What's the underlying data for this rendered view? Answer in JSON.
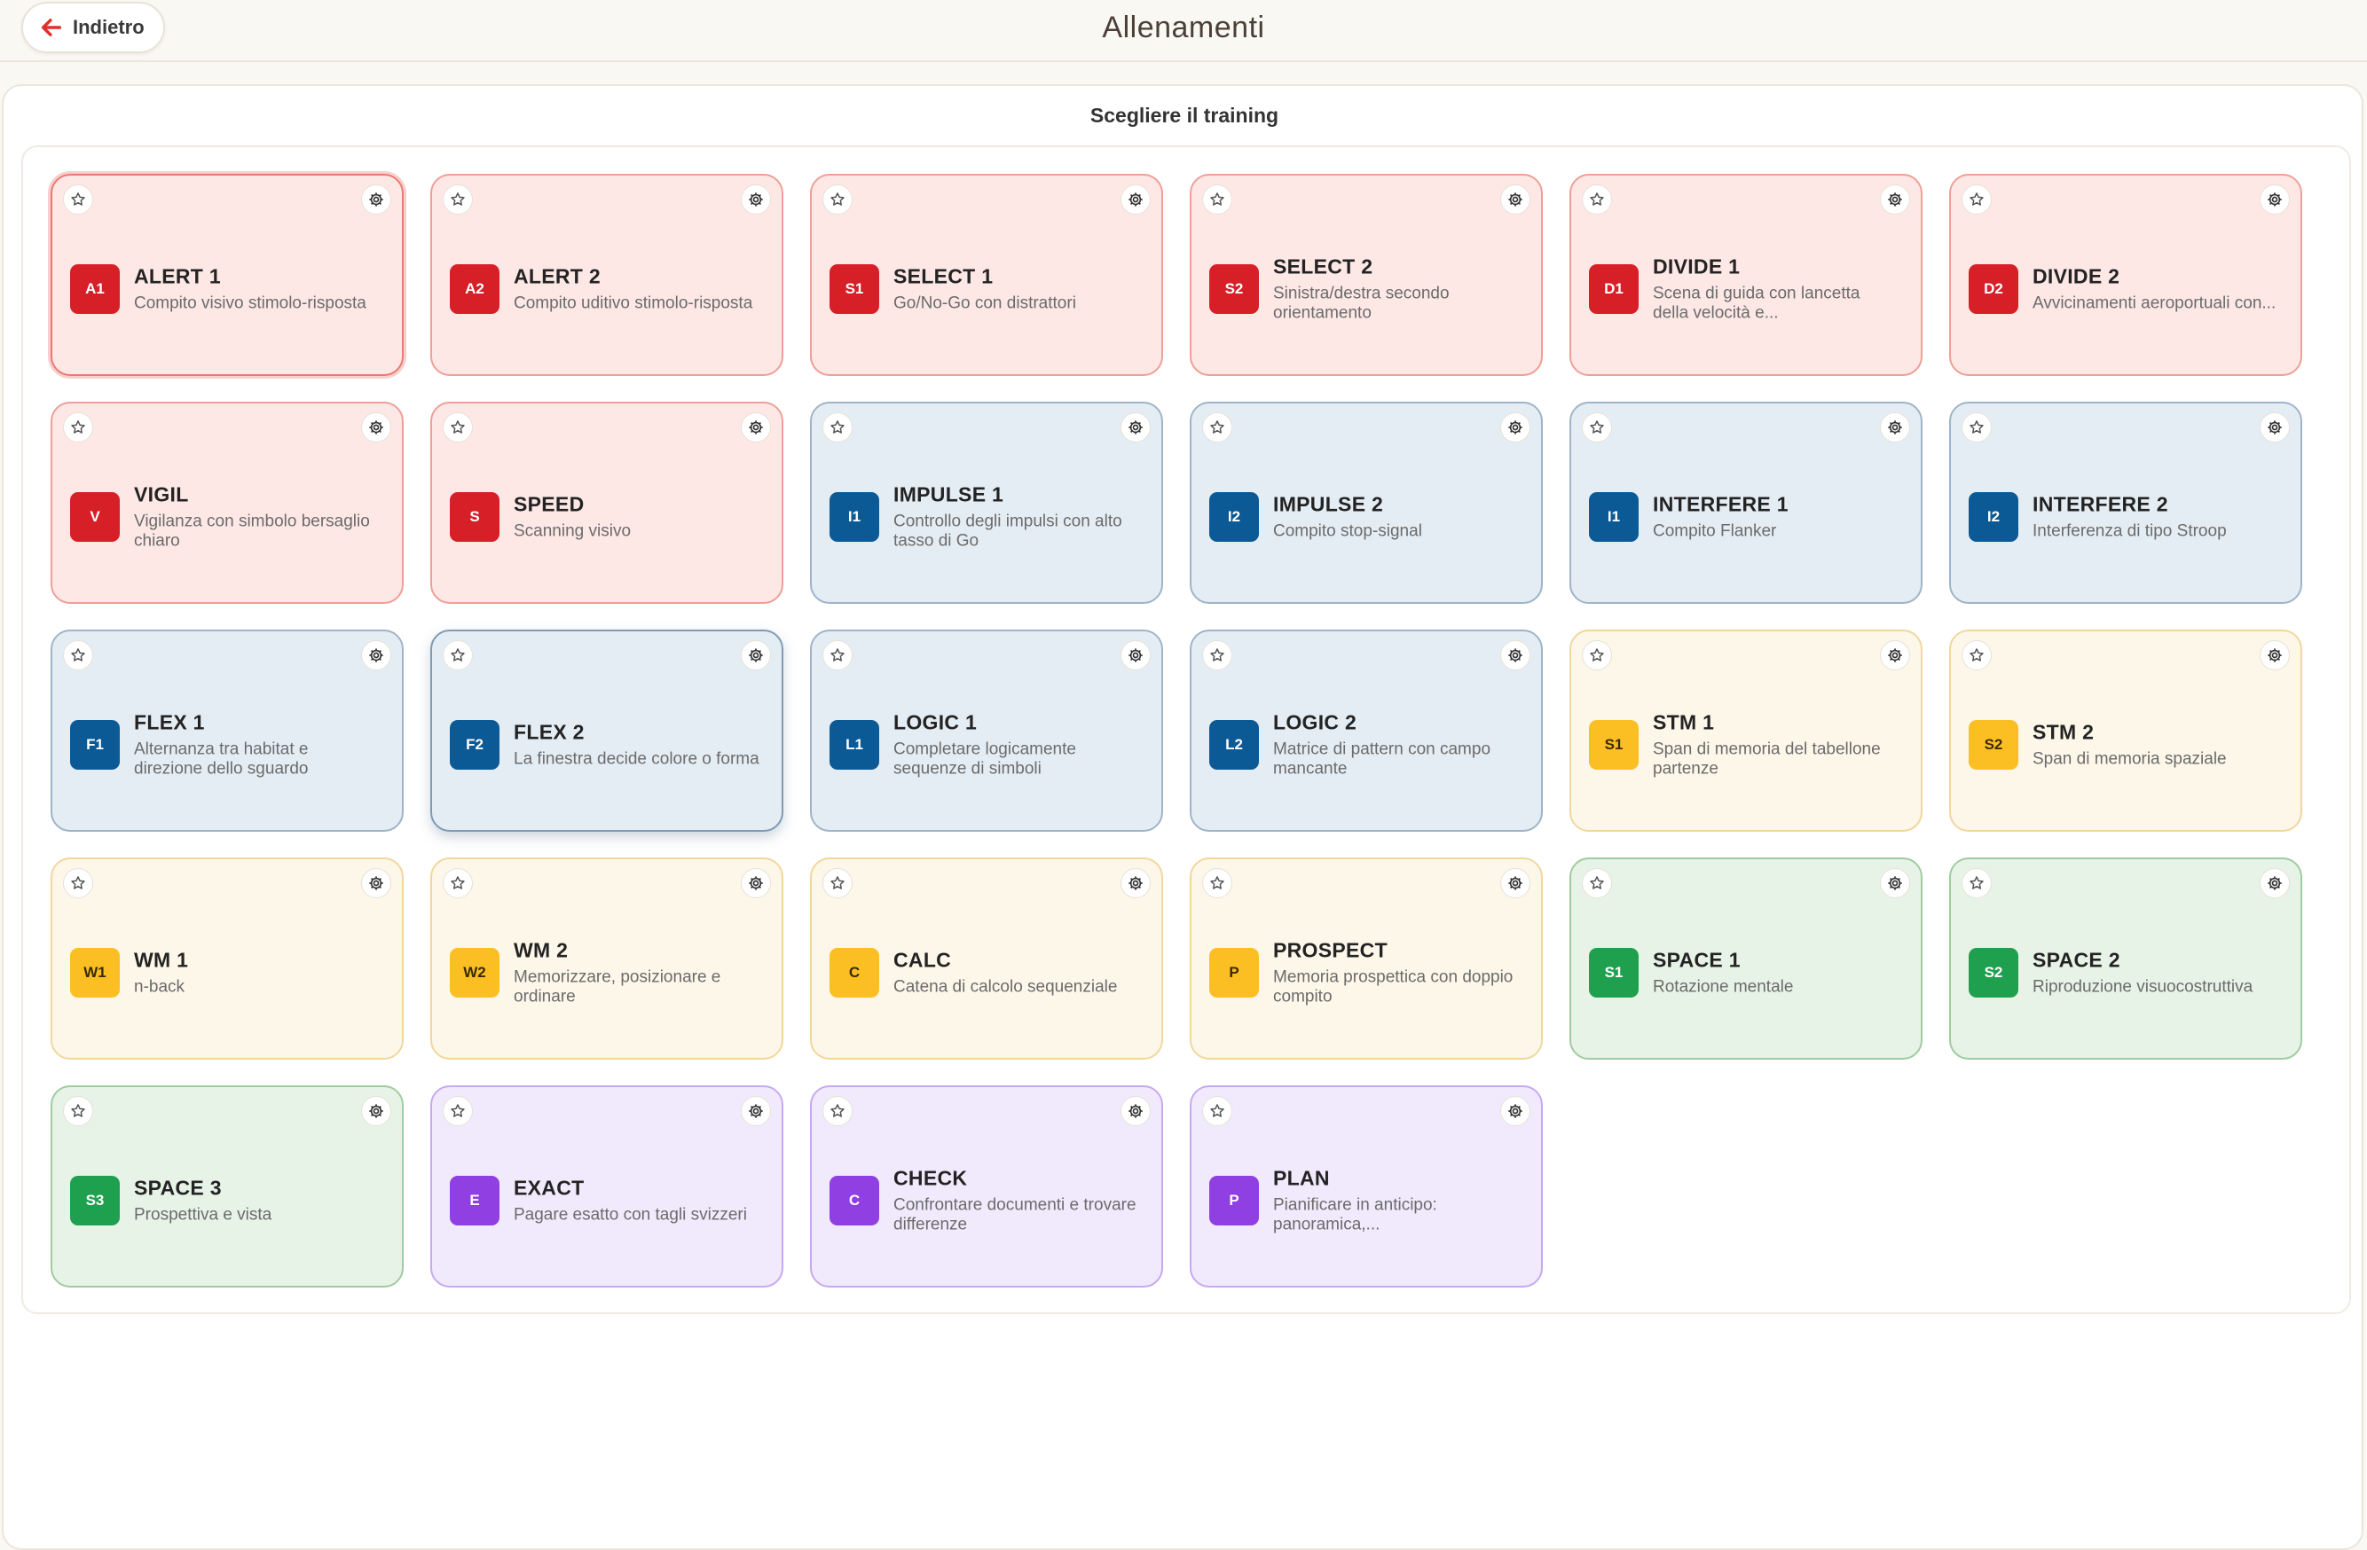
{
  "header": {
    "back_label": "Indietro",
    "title": "Allenamenti"
  },
  "panel": {
    "subtitle": "Scegliere il training"
  },
  "colors": {
    "red": "#d71f27",
    "blue": "#0b5a96",
    "yellow": "#fbbf24",
    "green": "#1fa04f",
    "purple": "#8f3fe2"
  },
  "cards": [
    {
      "code": "A1",
      "title": "ALERT 1",
      "desc": "Compito visivo stimolo-risposta",
      "color": "red"
    },
    {
      "code": "A2",
      "title": "ALERT 2",
      "desc": "Compito uditivo stimolo-risposta",
      "color": "red"
    },
    {
      "code": "S1",
      "title": "SELECT 1",
      "desc": "Go/No-Go con distrattori",
      "color": "red"
    },
    {
      "code": "S2",
      "title": "SELECT 2",
      "desc": "Sinistra/destra secondo orientamento",
      "color": "red"
    },
    {
      "code": "D1",
      "title": "DIVIDE 1",
      "desc": "Scena di guida con lancetta della velocità e...",
      "color": "red"
    },
    {
      "code": "D2",
      "title": "DIVIDE 2",
      "desc": "Avvicinamenti aeroportuali con...",
      "color": "red"
    },
    {
      "code": "V",
      "title": "VIGIL",
      "desc": "Vigilanza con simbolo bersaglio chiaro",
      "color": "red"
    },
    {
      "code": "S",
      "title": "SPEED",
      "desc": "Scanning visivo",
      "color": "red"
    },
    {
      "code": "I1",
      "title": "IMPULSE 1",
      "desc": "Controllo degli impulsi con alto tasso di Go",
      "color": "blue"
    },
    {
      "code": "I2",
      "title": "IMPULSE 2",
      "desc": "Compito stop-signal",
      "color": "blue"
    },
    {
      "code": "I1",
      "title": "INTERFERE 1",
      "desc": "Compito Flanker",
      "color": "blue"
    },
    {
      "code": "I2",
      "title": "INTERFERE 2",
      "desc": "Interferenza di tipo Stroop",
      "color": "blue"
    },
    {
      "code": "F1",
      "title": "FLEX 1",
      "desc": "Alternanza tra habitat e direzione dello sguardo",
      "color": "blue"
    },
    {
      "code": "F2",
      "title": "FLEX 2",
      "desc": "La finestra decide colore o forma",
      "color": "blue"
    },
    {
      "code": "L1",
      "title": "LOGIC 1",
      "desc": "Completare logicamente sequenze di simboli",
      "color": "blue"
    },
    {
      "code": "L2",
      "title": "LOGIC 2",
      "desc": "Matrice di pattern con campo mancante",
      "color": "blue"
    },
    {
      "code": "S1",
      "title": "STM 1",
      "desc": "Span di memoria del tabellone partenze",
      "color": "yellow"
    },
    {
      "code": "S2",
      "title": "STM 2",
      "desc": "Span di memoria spaziale",
      "color": "yellow"
    },
    {
      "code": "W1",
      "title": "WM 1",
      "desc": "n-back",
      "color": "yellow"
    },
    {
      "code": "W2",
      "title": "WM 2",
      "desc": "Memorizzare, posizionare e ordinare",
      "color": "yellow"
    },
    {
      "code": "C",
      "title": "CALC",
      "desc": "Catena di calcolo sequenziale",
      "color": "yellow"
    },
    {
      "code": "P",
      "title": "PROSPECT",
      "desc": "Memoria prospettica con doppio compito",
      "color": "yellow"
    },
    {
      "code": "S1",
      "title": "SPACE 1",
      "desc": "Rotazione mentale",
      "color": "green"
    },
    {
      "code": "S2",
      "title": "SPACE 2",
      "desc": "Riproduzione visuocostruttiva",
      "color": "green"
    },
    {
      "code": "S3",
      "title": "SPACE 3",
      "desc": "Prospettiva e vista",
      "color": "green"
    },
    {
      "code": "E",
      "title": "EXACT",
      "desc": "Pagare esatto con tagli svizzeri",
      "color": "purple"
    },
    {
      "code": "C",
      "title": "CHECK",
      "desc": "Confrontare documenti e trovare differenze",
      "color": "purple"
    },
    {
      "code": "P",
      "title": "PLAN",
      "desc": "Pianificare in anticipo: panoramica,...",
      "color": "purple"
    }
  ]
}
